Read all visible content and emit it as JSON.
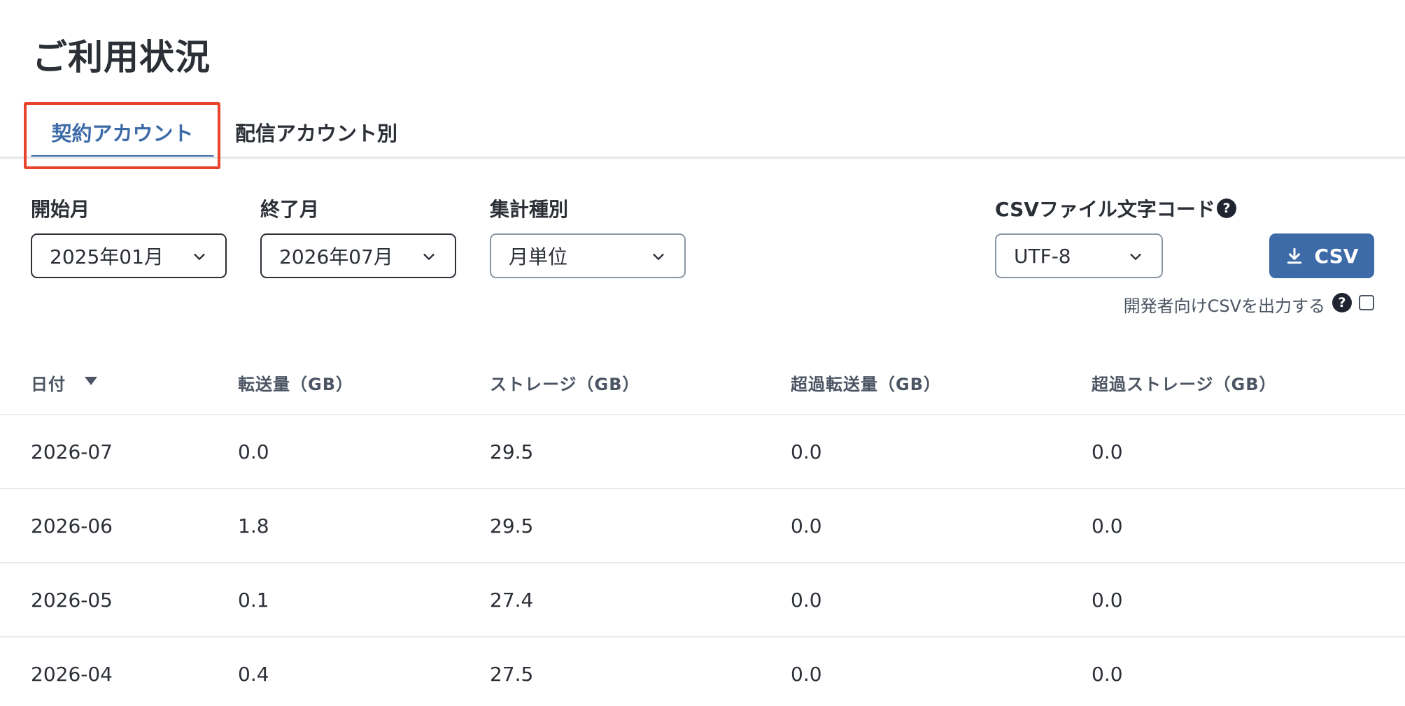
{
  "page": {
    "title": "ご利用状況"
  },
  "tabs": [
    {
      "label": "契約アカウント",
      "active": true
    },
    {
      "label": "配信アカウント別",
      "active": false
    }
  ],
  "filters": {
    "start_month": {
      "label": "開始月",
      "value": "2025年01月"
    },
    "end_month": {
      "label": "終了月",
      "value": "2026年07月"
    },
    "aggregation": {
      "label": "集計種別",
      "value": "月単位"
    },
    "encoding": {
      "label": "CSVファイル文字コード",
      "value": "UTF-8"
    }
  },
  "csv_button": {
    "label": "CSV"
  },
  "developer_csv": {
    "label": "開発者向けCSVを出力する",
    "checked": false
  },
  "help_icon_glyph": "?",
  "table": {
    "headers": [
      "日付",
      "転送量（GB）",
      "ストレージ（GB）",
      "超過転送量（GB）",
      "超過ストレージ（GB）"
    ],
    "rows": [
      [
        "2026-07",
        "0.0",
        "29.5",
        "0.0",
        "0.0"
      ],
      [
        "2026-06",
        "1.8",
        "29.5",
        "0.0",
        "0.0"
      ],
      [
        "2026-05",
        "0.1",
        "27.4",
        "0.0",
        "0.0"
      ],
      [
        "2026-04",
        "0.4",
        "27.5",
        "0.0",
        "0.0"
      ]
    ]
  },
  "colors": {
    "accent": "#3d6ba8",
    "highlight": "#e8442b",
    "text": "#2b2f36"
  }
}
